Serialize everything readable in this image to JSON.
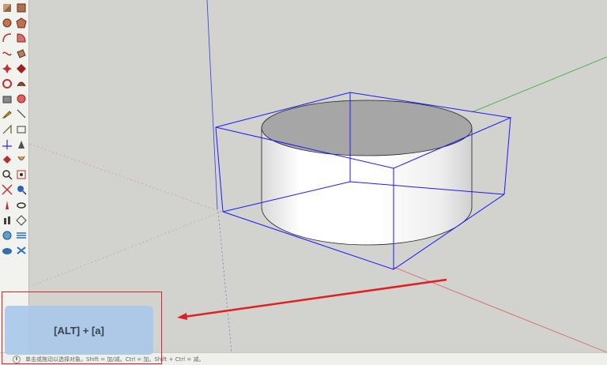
{
  "toolbar": {
    "tools": [
      [
        "select-tool-icon",
        "rectangle-tool-icon"
      ],
      [
        "circle-tool-icon",
        "polygon-tool-icon"
      ],
      [
        "arc-tool-icon",
        "pie-tool-icon"
      ],
      [
        "freehand-tool-icon",
        "pushpull-tool-icon"
      ],
      [
        "move-tool-icon",
        "scale-tool-icon"
      ],
      [
        "rotate-tool-icon",
        "followme-tool-icon"
      ],
      [
        "offset-tool-icon",
        "paint-tool-icon"
      ],
      [
        "tape-tool-icon",
        "dimension-tool-icon"
      ],
      [
        "protractor-tool-icon",
        "text-tool-icon"
      ],
      [
        "axes-tool-icon",
        "3dtext-tool-icon"
      ],
      [
        "orbit-tool-icon",
        "pan-tool-icon"
      ],
      [
        "zoom-tool-icon",
        "zoom-window-tool-icon"
      ],
      [
        "zoom-extents-tool-icon",
        "search-tool-icon"
      ],
      [
        "position-camera-tool-icon",
        "look-around-tool-icon"
      ],
      [
        "walk-tool-icon",
        "section-plane-tool-icon"
      ],
      [
        "sandbox-tool-icon",
        "sandbox-smooth-tool-icon"
      ],
      [
        "sandbox-stamp-tool-icon",
        "sandbox-drape-tool-icon"
      ]
    ]
  },
  "colors": {
    "viewport_bg": "#d2d2ce",
    "bbox_blue": "#1a1aff",
    "axis_red": "#d65a5a",
    "axis_green": "#3aa83a",
    "axis_blue": "#3a3ad6",
    "highlight_red": "#e02020",
    "overlay_blue": "#aac9ea"
  },
  "shortcut_overlay": {
    "text": "[ALT] + [a]"
  },
  "statusbar": {
    "text": "单击或拖动以选择对象。Shift = 加/减。Ctrl = 加。Shift + Ctrl = 减。"
  }
}
